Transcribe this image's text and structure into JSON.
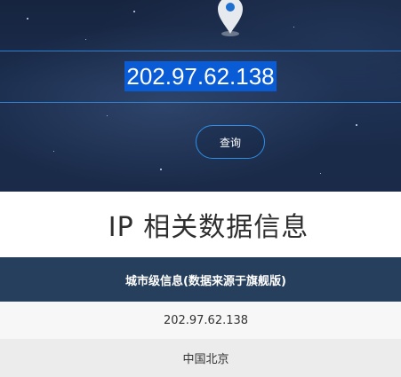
{
  "search": {
    "ip_value": "202.97.62.138",
    "query_label": "查询"
  },
  "section": {
    "title": "IP 相关数据信息"
  },
  "table": {
    "header": "城市级信息(数据来源于旗舰版)",
    "rows": [
      "202.97.62.138",
      "中国北京"
    ]
  },
  "colors": {
    "accent": "#2e8fe6",
    "header_bg": "#263f5c",
    "selection": "#0a5bd6"
  },
  "icons": {
    "pin": "location-pin-icon"
  }
}
